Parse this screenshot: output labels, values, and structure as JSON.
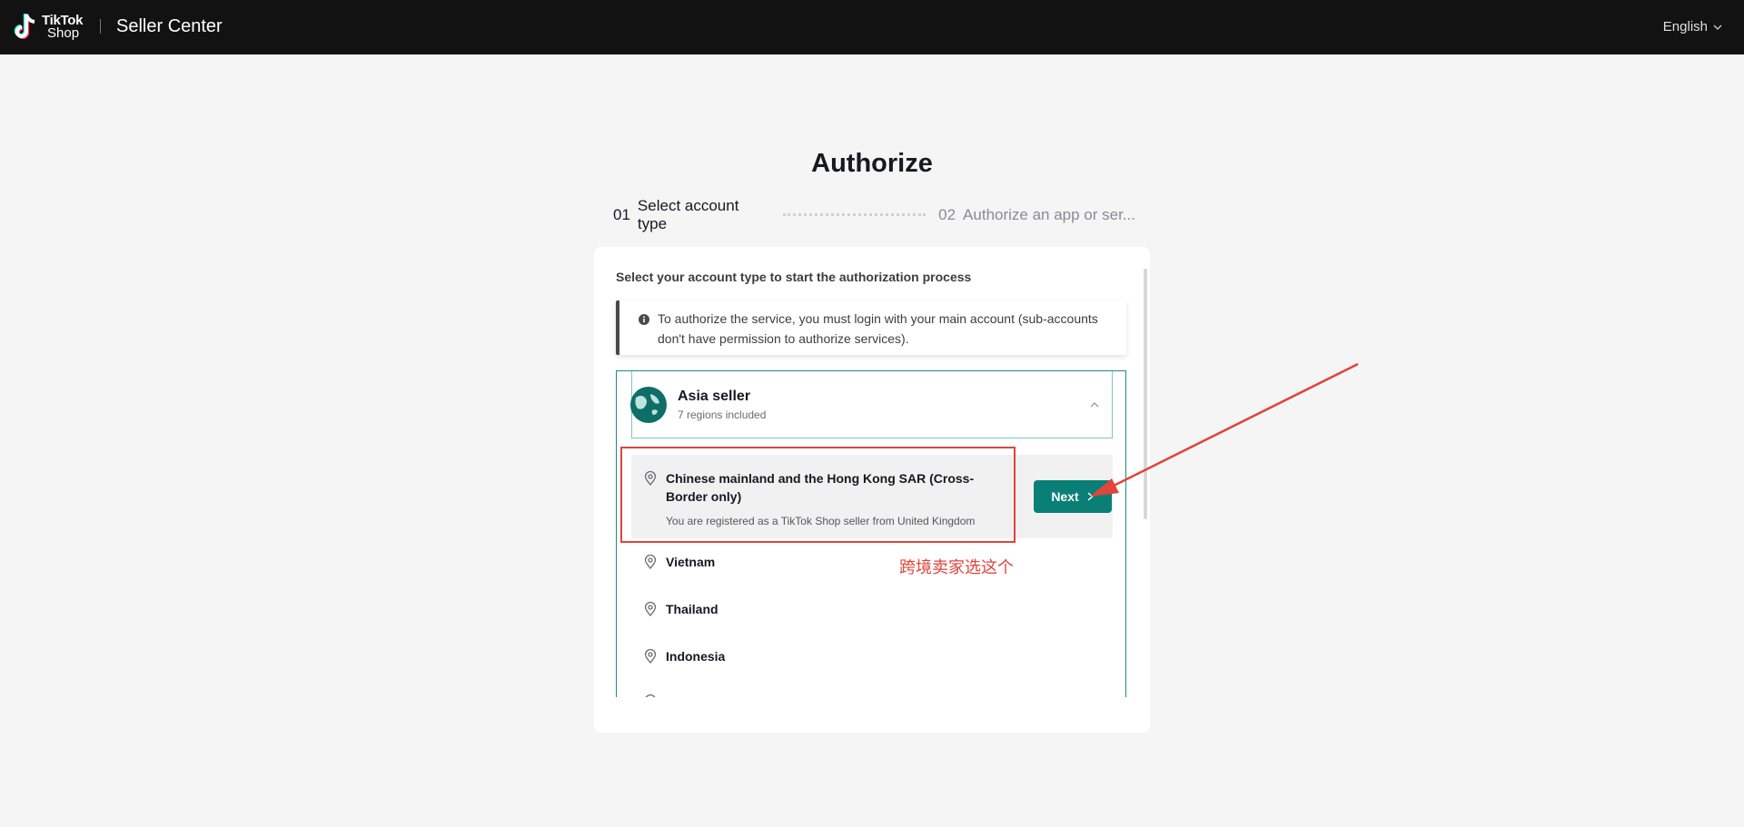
{
  "header": {
    "logo_line1": "TikTok",
    "logo_line2": "Shop",
    "app_title": "Seller Center",
    "language": "English"
  },
  "page": {
    "title": "Authorize"
  },
  "steps": [
    {
      "num": "01",
      "label": "Select account type"
    },
    {
      "num": "02",
      "label": "Authorize an app or ser..."
    }
  ],
  "card": {
    "description": "Select your account type to start the authorization process",
    "notice": "To authorize the service, you must login with your main account (sub-accounts don't have permission to authorize services)."
  },
  "group": {
    "title": "Asia seller",
    "subtitle": "7 regions included"
  },
  "selected_region": {
    "title": "Chinese mainland and the Hong Kong SAR (Cross-Border only)",
    "subtitle": "You are registered as a TikTok Shop seller from United Kingdom",
    "next_label": "Next"
  },
  "regions": [
    "Vietnam",
    "Thailand",
    "Indonesia"
  ],
  "annotation": {
    "label": "跨境卖家选这个",
    "color": "#e0443a"
  },
  "colors": {
    "accent": "#0a7f76",
    "topbar": "#121212"
  }
}
